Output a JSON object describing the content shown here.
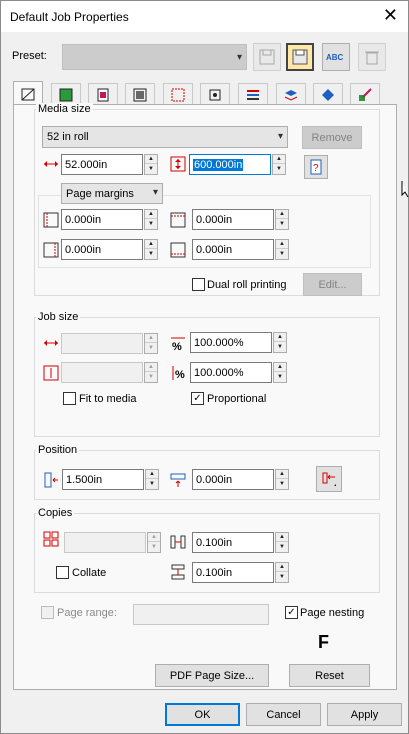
{
  "window": {
    "title": "Default Job Properties"
  },
  "preset": {
    "label": "Preset:",
    "value": ""
  },
  "media_size": {
    "group_label": "Media size",
    "selected": "52 in roll",
    "remove_label": "Remove",
    "width": "52.000in",
    "length": "600.000in",
    "margins_mode": "Page margins",
    "margin_left": "0.000in",
    "margin_top": "0.000in",
    "margin_right": "0.000in",
    "margin_bottom": "0.000in",
    "dual_roll_label": "Dual roll printing",
    "dual_roll_checked": false,
    "edit_label": "Edit..."
  },
  "job_size": {
    "group_label": "Job size",
    "width": "",
    "height": "",
    "scale_x": "100.000%",
    "scale_y": "100.000%",
    "fit_label": "Fit to media",
    "fit_checked": false,
    "proportional_label": "Proportional",
    "proportional_checked": true
  },
  "position": {
    "group_label": "Position",
    "x": "1.500in",
    "y": "0.000in"
  },
  "copies": {
    "group_label": "Copies",
    "count": "",
    "h_gap": "0.100in",
    "v_gap": "0.100in",
    "collate_label": "Collate",
    "collate_checked": false
  },
  "page_range": {
    "label": "Page range:",
    "value": "",
    "checked": false
  },
  "page_nesting": {
    "label": "Page nesting",
    "checked": true
  },
  "overlay_letter": "F",
  "buttons": {
    "pdf_page_size": "PDF Page Size...",
    "reset": "Reset",
    "ok": "OK",
    "cancel": "Cancel",
    "apply": "Apply"
  },
  "toolbar": {
    "icons": [
      "save-icon-disabled",
      "save-active-icon",
      "spell-check-icon",
      "delete-icon-disabled"
    ],
    "abc_text": "ABC"
  },
  "colors": {
    "accent": "#0078d7",
    "icon_red": "#d40000",
    "icon_blue": "#1f5fbf"
  }
}
